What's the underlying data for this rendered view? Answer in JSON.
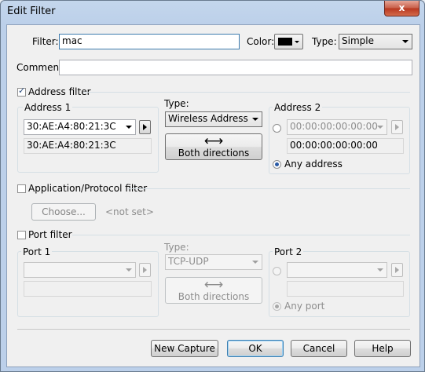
{
  "window": {
    "title": "Edit Filter",
    "close_label": "x"
  },
  "filter": {
    "label": "Filter:",
    "value": "mac"
  },
  "color": {
    "label": "Color:",
    "value": "#000000"
  },
  "type": {
    "label": "Type:",
    "value": "Simple"
  },
  "comment": {
    "label": "Comment:",
    "value": ""
  },
  "address_filter": {
    "label": "Address filter",
    "checked": true,
    "address1": {
      "label": "Address 1",
      "combo_value": "30:AE:A4:80:21:3C",
      "resolved": "30:AE:A4:80:21:3C"
    },
    "type_label": "Type:",
    "type_value": "Wireless Address",
    "direction_icon": "double-arrow-icon",
    "direction_label": "Both directions",
    "address2": {
      "label": "Address 2",
      "combo_value": "00:00:00:00:00:00",
      "resolved": "00:00:00:00:00:00",
      "any_label": "Any address",
      "any_selected": true
    }
  },
  "app_filter": {
    "label": "Application/Protocol filter",
    "checked": false,
    "choose_label": "Choose...",
    "not_set": "<not set>"
  },
  "port_filter": {
    "label": "Port filter",
    "checked": false,
    "port1": {
      "label": "Port 1",
      "combo_value": "",
      "resolved": ""
    },
    "type_label": "Type:",
    "type_value": "TCP-UDP",
    "direction_icon": "double-arrow-icon",
    "direction_label": "Both directions",
    "port2": {
      "label": "Port 2",
      "combo_value": "",
      "resolved": "",
      "any_label": "Any port",
      "any_selected": true
    }
  },
  "buttons": {
    "new_capture": "New Capture",
    "ok": "OK",
    "cancel": "Cancel",
    "help": "Help"
  }
}
